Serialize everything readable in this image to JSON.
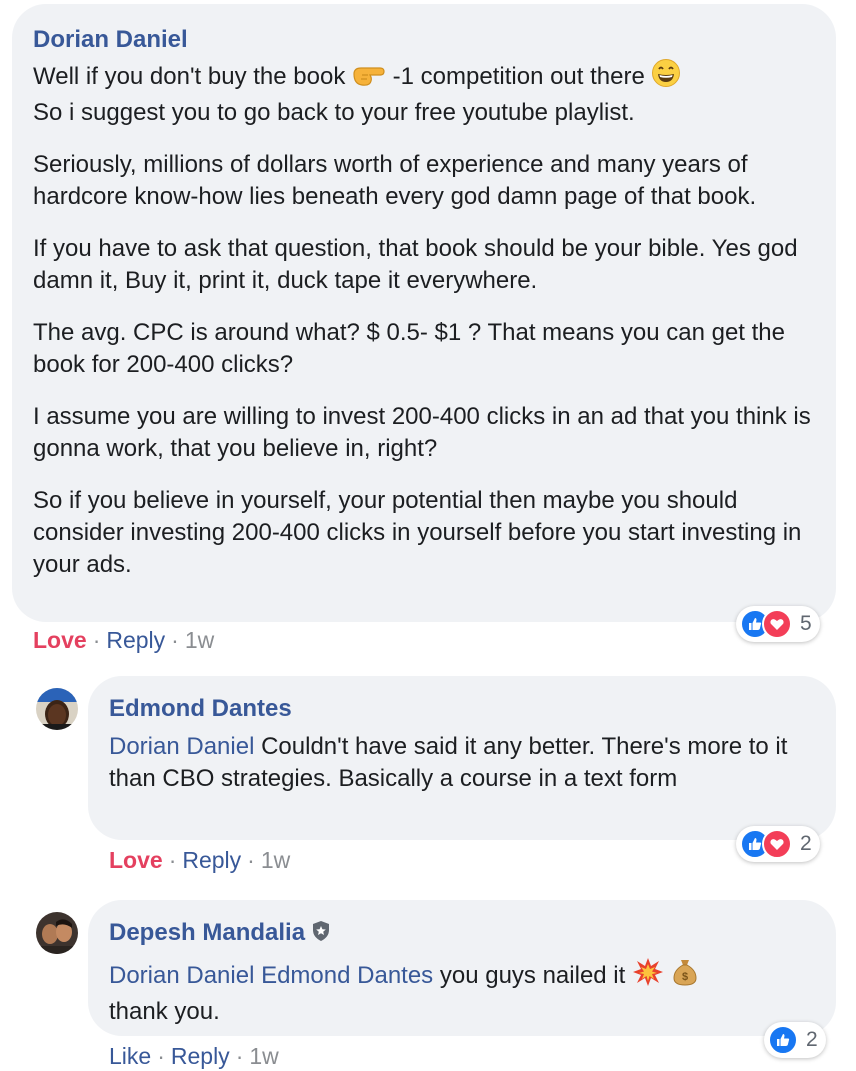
{
  "comments": [
    {
      "author": "Dorian Daniel",
      "paragraphs": [
        {
          "p1": "Well if you don't buy the book",
          "p2": "-1 competition out there",
          "p3": "So i suggest you to go back to your free youtube playlist."
        },
        "Seriously, millions of dollars worth of experience and many years of hardcore know-how lies beneath every god damn page of that book.",
        "If you have to ask that question, that book should be your bible. Yes god damn it, Buy it, print it, duck tape it everywhere.",
        "The avg. CPC is around what? $ 0.5- $1 ? That means you can get the book for 200-400 clicks?",
        "I assume you are willing to invest 200-400 clicks in an ad that you think is gonna work, that you believe in, right?",
        "So if you believe in yourself, your potential then maybe you should consider investing 200-400 clicks in yourself before you start investing in your ads."
      ],
      "actions": {
        "love": "Love",
        "reply": "Reply",
        "time": "1w",
        "sep": "·"
      },
      "reaction_count": "5"
    },
    {
      "author": "Edmond Dantes",
      "mention": "Dorian Daniel",
      "text": "Couldn't have said it any better. There's more to it than CBO strategies. Basically a course in a text form",
      "actions": {
        "love": "Love",
        "reply": "Reply",
        "time": "1w",
        "sep": "·"
      },
      "reaction_count": "2"
    },
    {
      "author": "Depesh Mandalia",
      "mentions": [
        "Dorian Daniel",
        "Edmond Dantes"
      ],
      "text": "you guys nailed it",
      "text2": "thank you.",
      "actions": {
        "like": "Like",
        "reply": "Reply",
        "time": "1w",
        "sep": "·"
      },
      "reaction_count": "2"
    }
  ],
  "colors": {
    "link": "#385898",
    "love": "#e4405f",
    "bubble": "#f0f2f5",
    "like_blue": "#1877f2",
    "heart_red": "#f33e58"
  },
  "icons": [
    "pointing-right-emoji",
    "grinning-emoji",
    "collision-emoji",
    "money-bag-emoji",
    "like-reaction-icon",
    "love-reaction-icon",
    "shield-badge-icon"
  ]
}
